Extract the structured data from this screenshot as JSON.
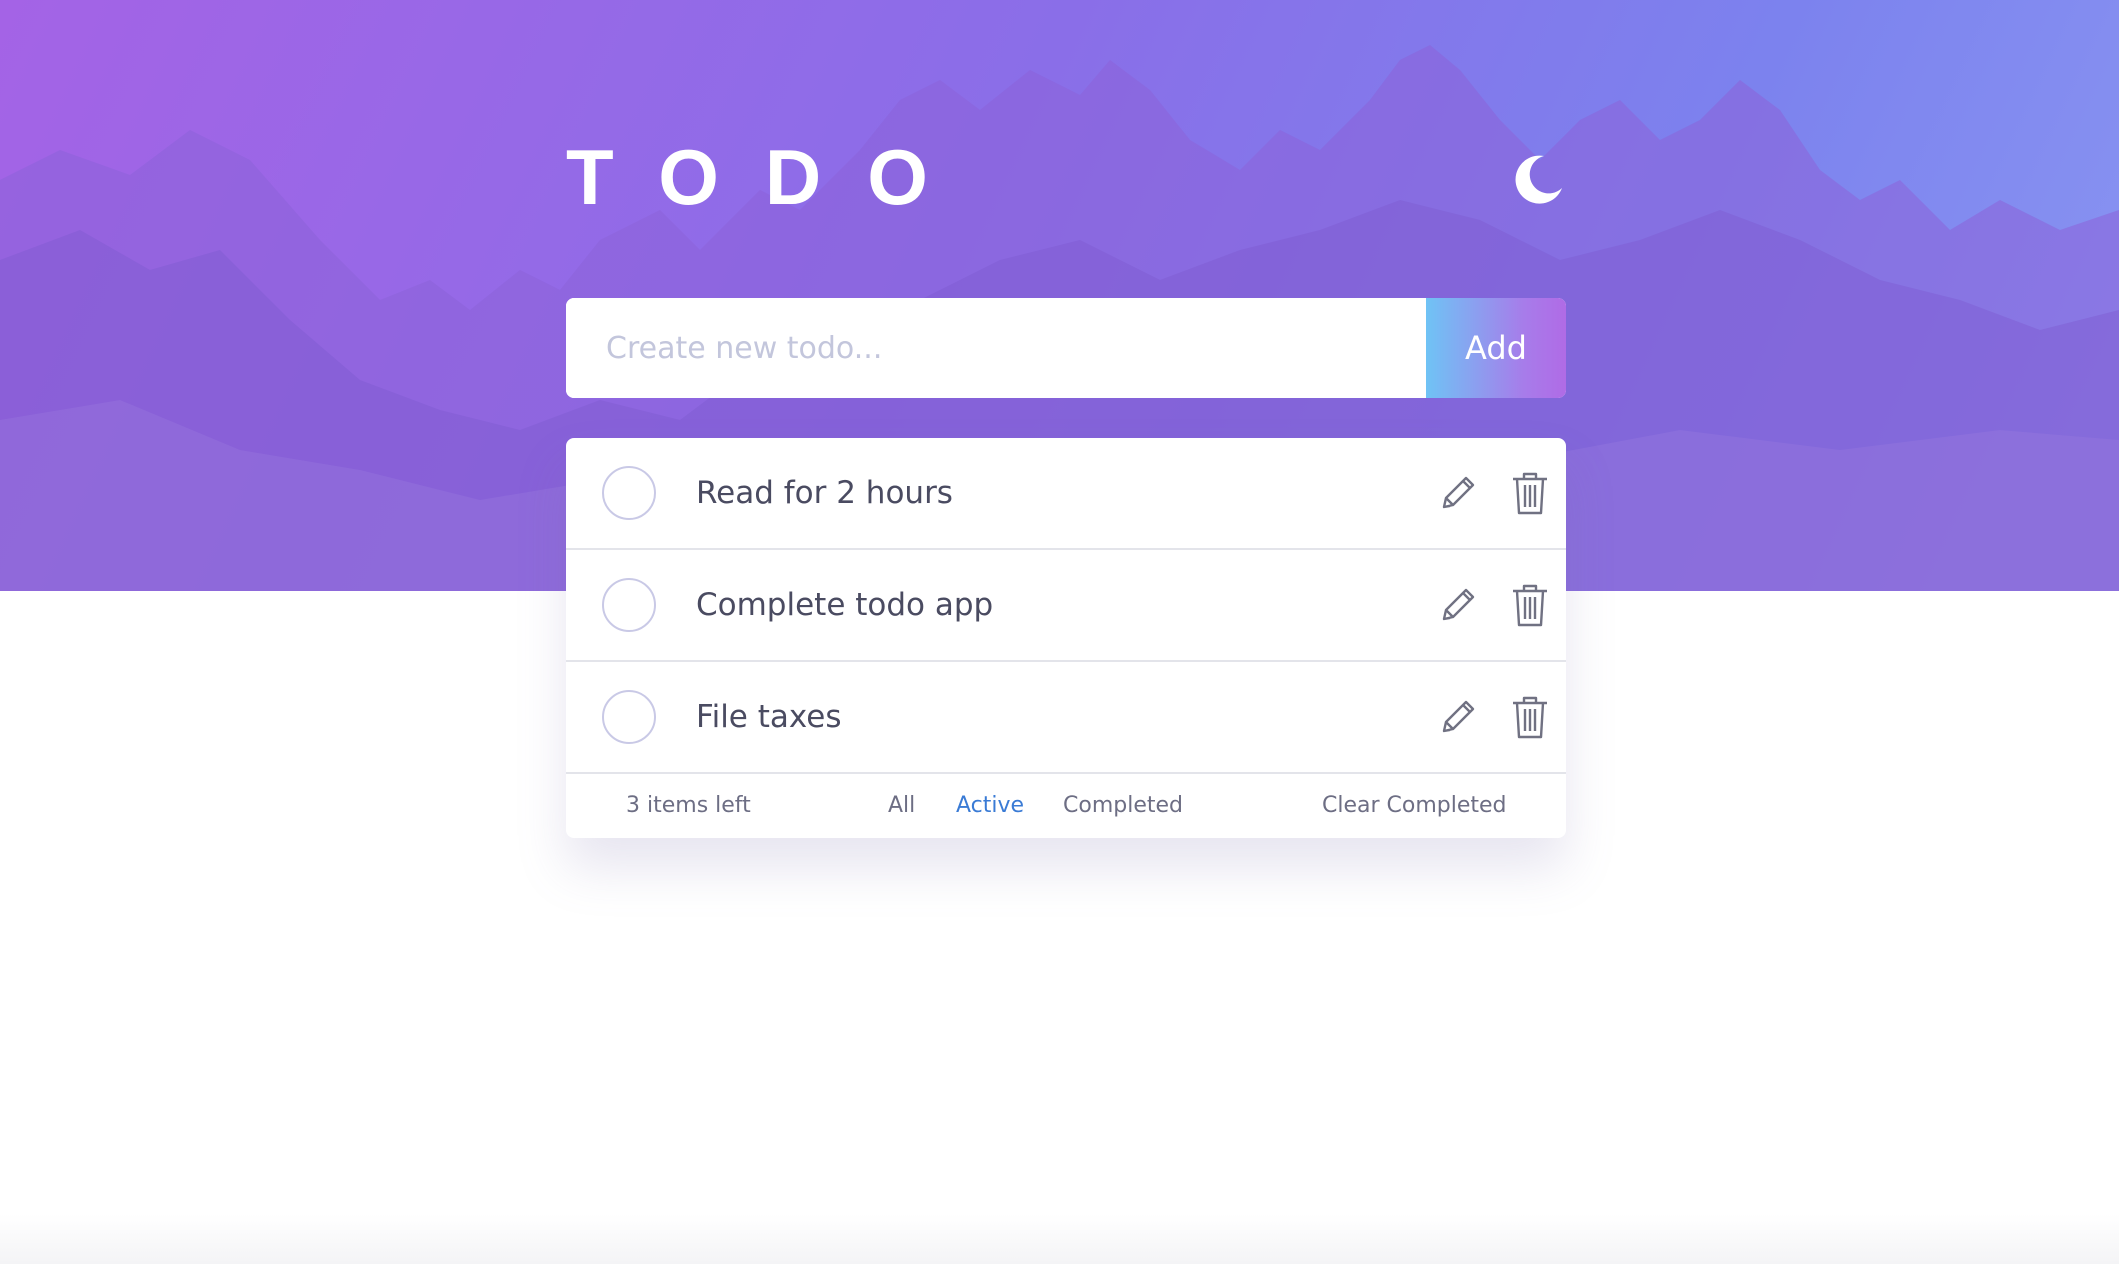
{
  "header": {
    "title": "TODO",
    "theme_toggle_icon": "moon-icon"
  },
  "new_todo": {
    "placeholder": "Create new todo...",
    "value": "",
    "add_label": "Add"
  },
  "todos": [
    {
      "text": "Read for 2 hours",
      "completed": false
    },
    {
      "text": "Complete todo app",
      "completed": false
    },
    {
      "text": "File taxes",
      "completed": false
    }
  ],
  "footer": {
    "items_left": "3 items left",
    "filters": [
      "All",
      "Active",
      "Completed"
    ],
    "active_filter": "Active",
    "clear_label": "Clear Completed"
  },
  "colors": {
    "hero_gradient_start": "#a463e6",
    "hero_gradient_end": "#8a96f2",
    "active_filter": "#3a7bd5",
    "text": "#4a4b61"
  },
  "icons": {
    "edit": "pencil-icon",
    "delete": "trash-icon",
    "checkbox": "circle-checkbox"
  }
}
